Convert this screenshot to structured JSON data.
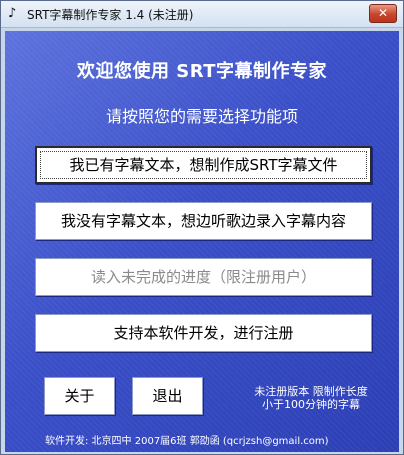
{
  "window": {
    "title": "SRT字幕制作专家 1.4 (未注册)",
    "close_glyph": "✕",
    "app_icon": "music-note-icon",
    "app_icon_glyph": "♪"
  },
  "main": {
    "heading": "欢迎您使用 SRT字幕制作专家",
    "subheading": "请按照您的需要选择功能项",
    "buttons": [
      {
        "label": "我已有字幕文本，想制作成SRT字幕文件",
        "state": "focused"
      },
      {
        "label": "我没有字幕文本，想边听歌边录入字幕内容",
        "state": "normal"
      },
      {
        "label": "读入未完成的进度（限注册用户）",
        "state": "disabled"
      },
      {
        "label": "支持本软件开发，进行注册",
        "state": "normal"
      }
    ],
    "about_label": "关于",
    "exit_label": "退出",
    "notice_line1": "未注册版本 限制作长度",
    "notice_line2": "小于100分钟的字幕"
  },
  "footer": {
    "text": "软件开发: 北京四中 2007届6班 郭劭函 (qcrjzsh@gmail.com)"
  },
  "colors": {
    "client_background": "#3a4fc8",
    "close_button": "#c8452c"
  }
}
